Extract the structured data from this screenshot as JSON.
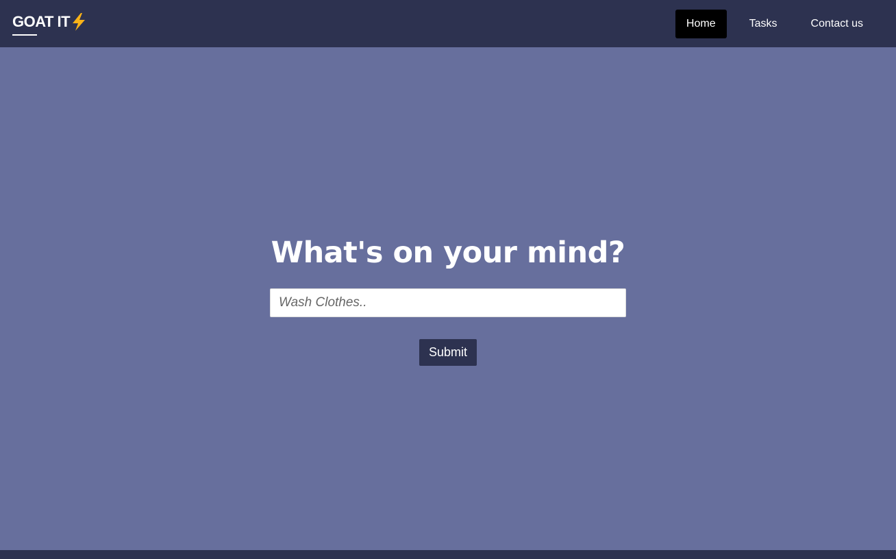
{
  "navbar": {
    "brand": "GOAT IT",
    "brand_icon": "lightning-bolt-icon",
    "links": [
      {
        "label": "Home",
        "active": true
      },
      {
        "label": "Tasks",
        "active": false
      },
      {
        "label": "Contact us",
        "active": false
      }
    ]
  },
  "hero": {
    "title": "What's on your mind?",
    "input_placeholder": "Wash Clothes..",
    "input_value": "",
    "submit_label": "Submit"
  },
  "colors": {
    "background": "#676f9d",
    "navbar": "#2d3250",
    "active_link": "#000000",
    "bolt": "#f9b218"
  }
}
